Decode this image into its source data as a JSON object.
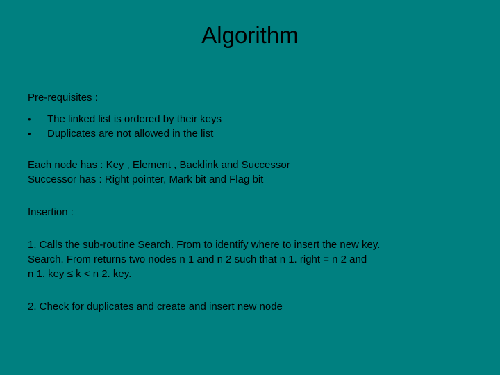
{
  "title": "Algorithm",
  "prereq_label": "Pre-requisites :",
  "bullets": [
    "The linked list is ordered by their keys",
    "Duplicates are not allowed in the list"
  ],
  "node_line": "Each node has  :  Key , Element , Backlink and Successor",
  "succ_line": "Successor has   : Right pointer, Mark bit and Flag bit",
  "insertion_label": "Insertion :",
  "step1a": "1. Calls the sub-routine Search. From to identify where to insert the new key.",
  "step1b": "Search. From  returns two nodes n 1 and n 2 such that   n 1. right = n 2 and",
  "step1c": " n 1. key ≤ k < n 2. key.",
  "step2": "2. Check for duplicates and create and insert new node",
  "bullet_char": "•"
}
